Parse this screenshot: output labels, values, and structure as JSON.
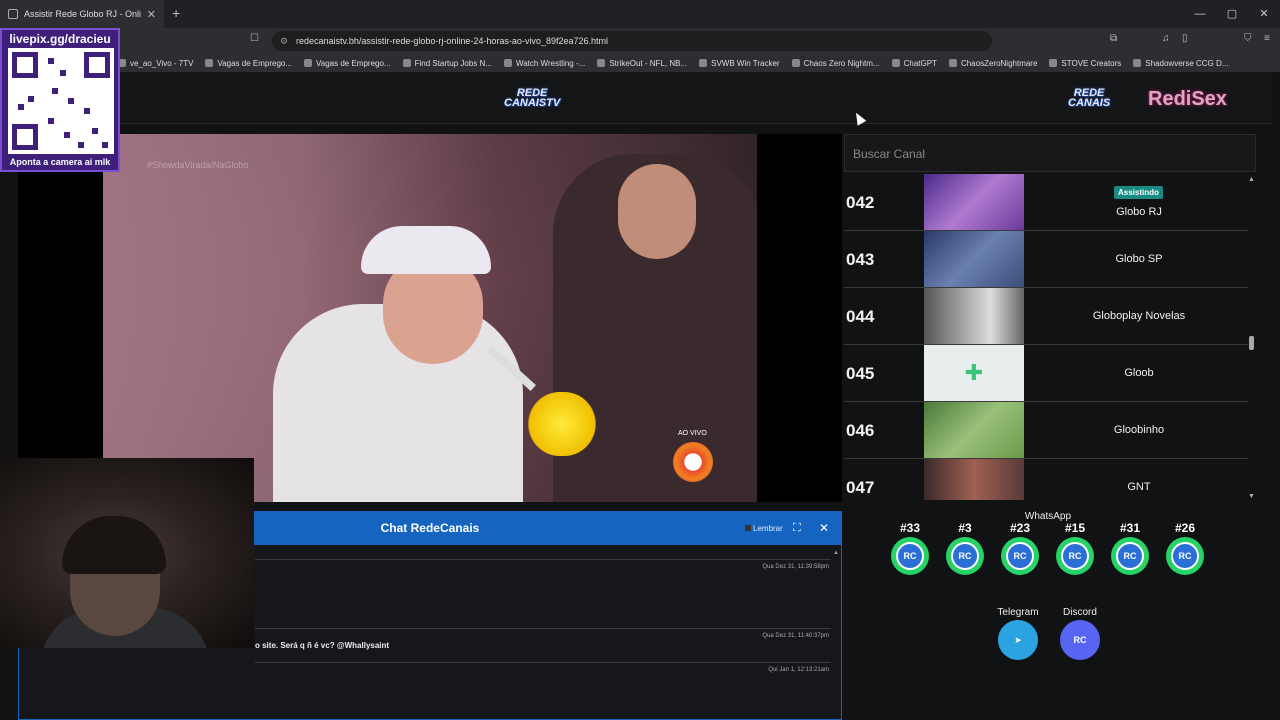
{
  "browser": {
    "tab_title": "Assistir Rede Globo RJ - Onli",
    "url": "redecanaistv.bh/assistir-rede-globo-rj-online-24-horas-ao-vivo_89f2ea726.html",
    "bookmarks": [
      "ve_ao_Vivo - 7TV",
      "Vagas de Emprego...",
      "Vagas de Emprego...",
      "Find Startup Jobs N...",
      "Watch Wrestling -...",
      "StrikeOut - NFL, NB...",
      "SVWB Win Tracker",
      "Chaos Zero Nightm...",
      "ChatGPT",
      "ChaosZeroNightmare",
      "STOVE Creators",
      "Shadowverse CCG D..."
    ]
  },
  "overlay": {
    "top": "livepix.gg/dracieu",
    "bottom": "Aponta a camera ai mlk"
  },
  "header": {
    "logo_left_1": "REDE",
    "logo_left_2": "CANAISTV",
    "logo_right_1": "REDE",
    "logo_right_2": "CANAIS",
    "logo_right_3": "RediSex"
  },
  "player": {
    "watermark": "#ShowdaVirada/NaGlobo",
    "live_label": "AO VIVO"
  },
  "search": {
    "placeholder": "Buscar Canal"
  },
  "channels": [
    {
      "num": "042",
      "name": "Globo RJ",
      "badge": "Assistindo",
      "thumb": "#6b3a9a"
    },
    {
      "num": "043",
      "name": "Globo SP",
      "thumb": "#3b4e7a"
    },
    {
      "num": "044",
      "name": "Globoplay Novelas",
      "thumb": "#7a7a7a"
    },
    {
      "num": "045",
      "name": "Gloob",
      "thumb": "#e8eeee"
    },
    {
      "num": "046",
      "name": "Gloobinho",
      "thumb": "#6a9a4a"
    },
    {
      "num": "047",
      "name": "GNT",
      "thumb": "#5a3a3a"
    }
  ],
  "chat": {
    "title": "Chat RedeCanais",
    "remember": "Lembrar",
    "messages": [
      {
        "time": "Qua Dez 31, 11:39:58pm",
        "text": ""
      },
      {
        "time": "Qua Dez 31, 11:40:37pm",
        "text": "o site. Será q ñ é vc? @Whallysaint"
      },
      {
        "time": "Qui Jan 1, 12:13:21am",
        "text": ""
      }
    ]
  },
  "social": {
    "whatsapp_title": "WhatsApp",
    "whatsapp": [
      "#33",
      "#3",
      "#23",
      "#15",
      "#31",
      "#26"
    ],
    "icon_text": "RC",
    "telegram": "Telegram",
    "discord": "Discord"
  },
  "colors": {
    "chat_header": "#1565c0",
    "whatsapp": "#25d366",
    "telegram": "#2aa3e0",
    "discord": "#5865f2",
    "badge": "#1a8a82"
  }
}
